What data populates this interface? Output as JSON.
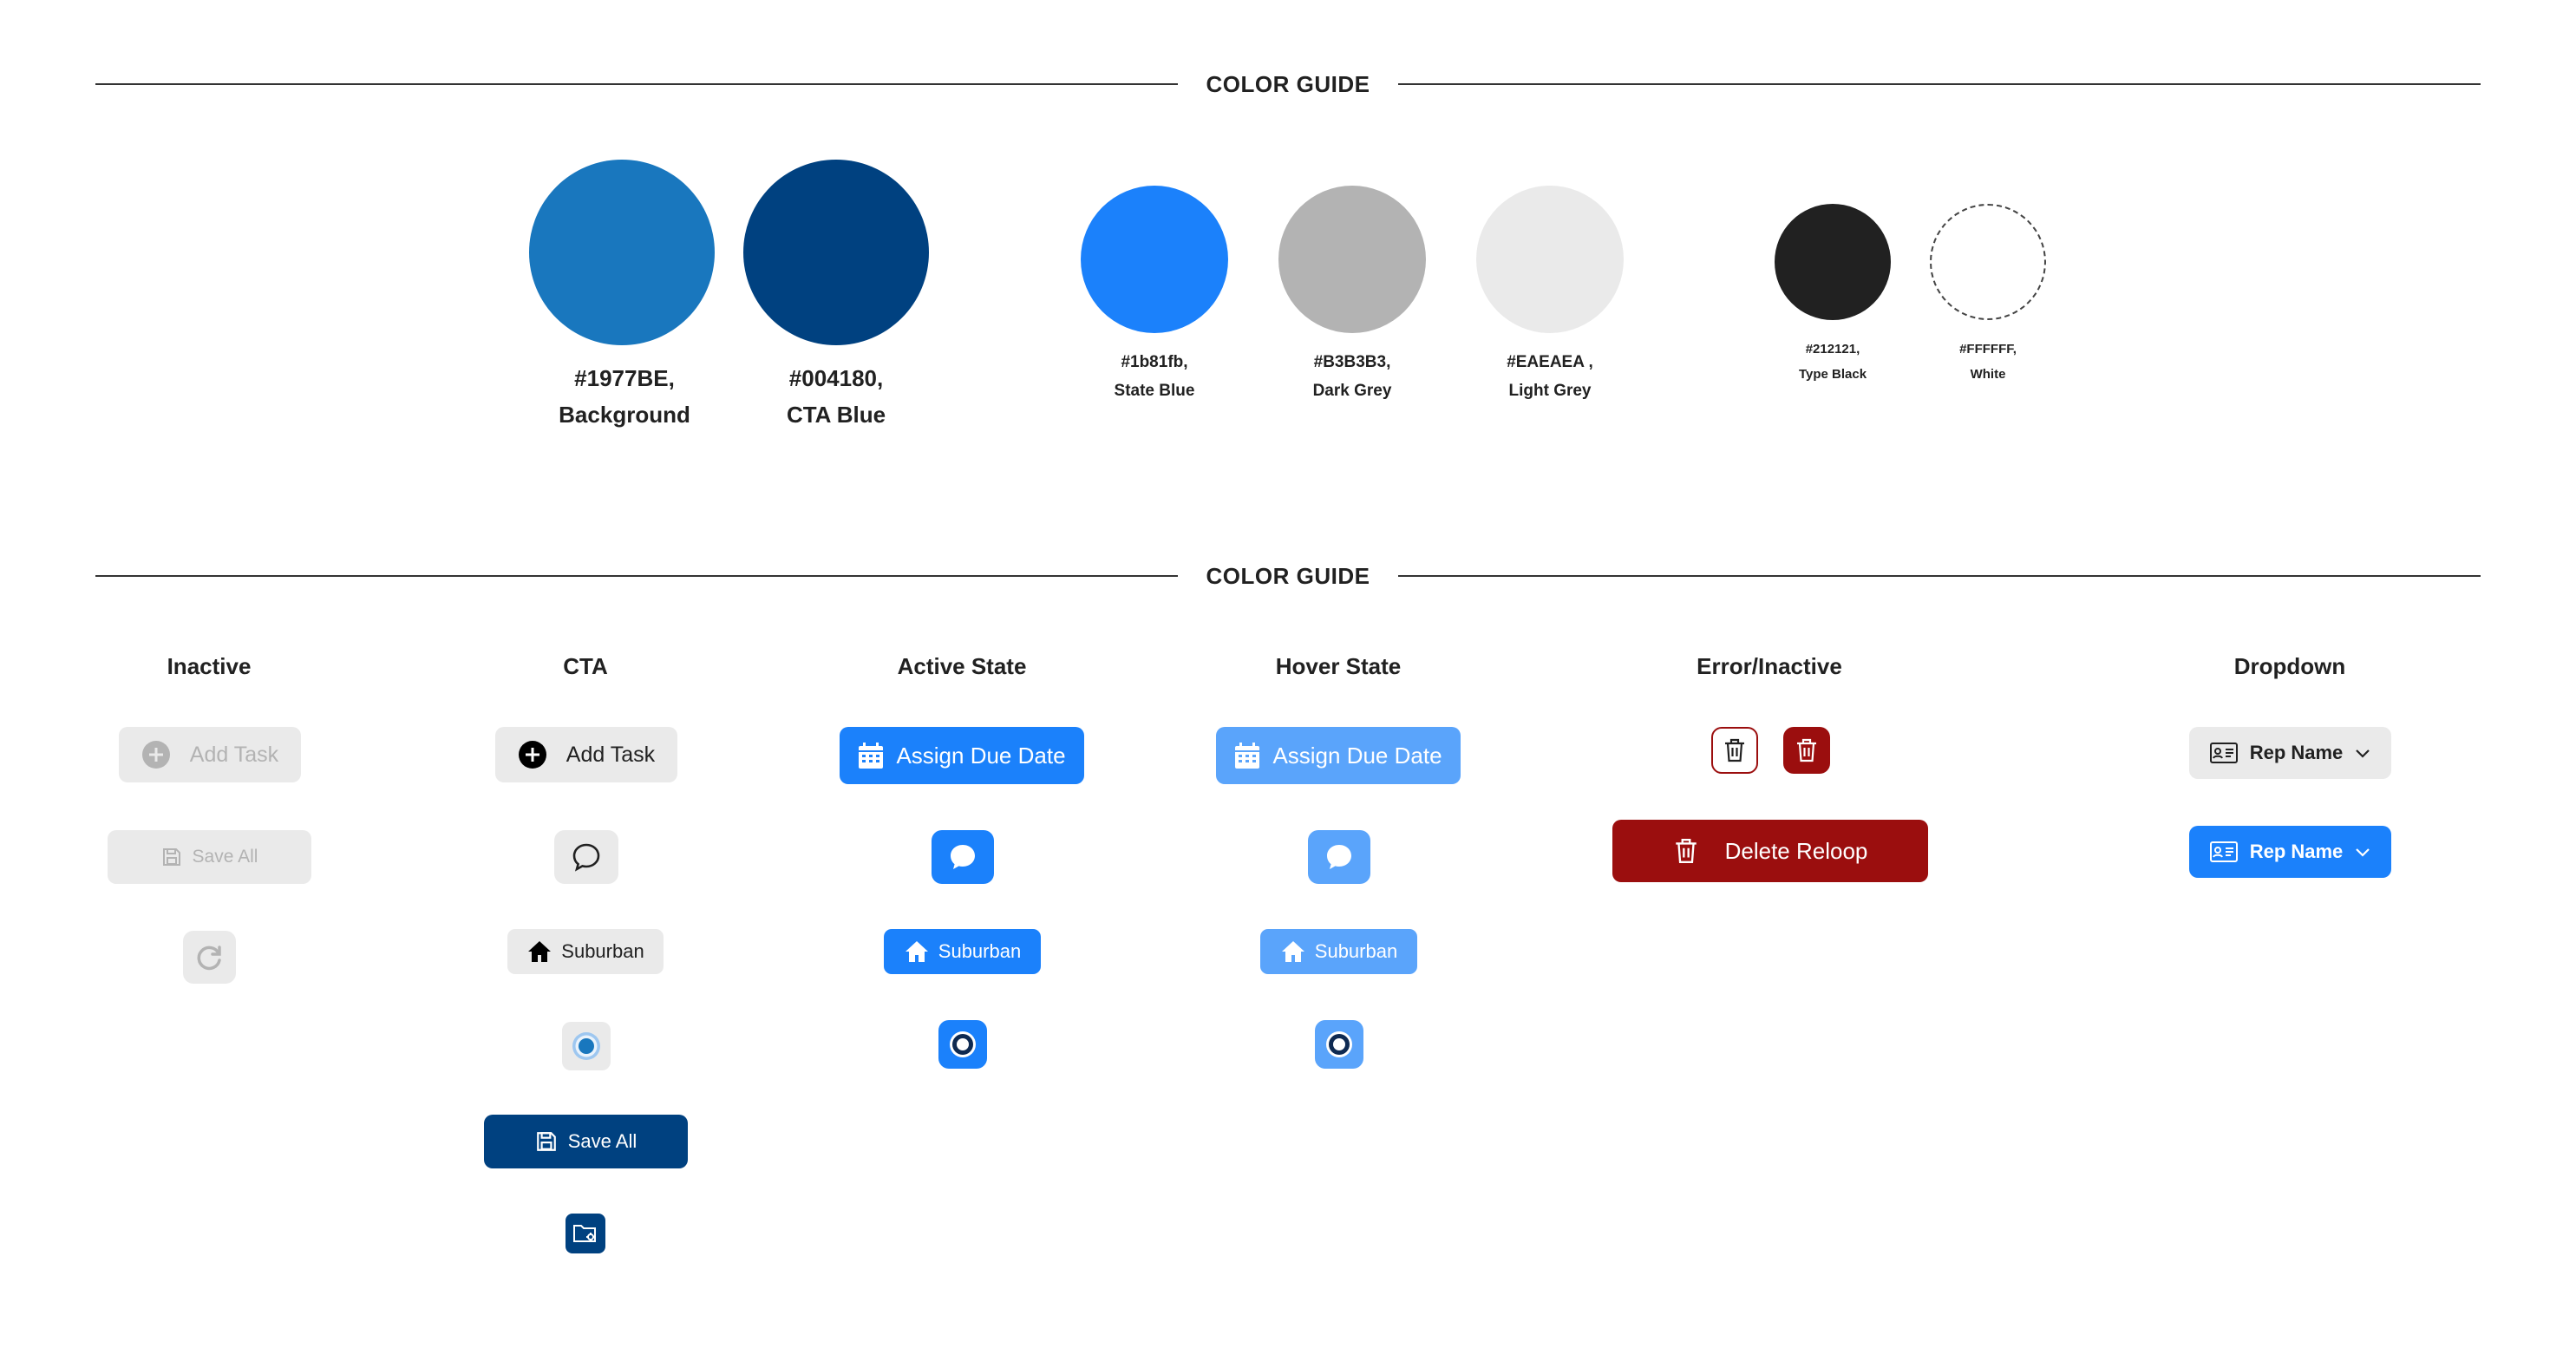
{
  "sections": {
    "top_title": "COLOR GUIDE",
    "bottom_title": "COLOR GUIDE"
  },
  "swatches": [
    {
      "hex": "#1977BE",
      "label_line1": "#1977BE,",
      "label_line2": "Background",
      "color": "#1977BE"
    },
    {
      "hex": "#004180",
      "label_line1": "#004180,",
      "label_line2": "CTA Blue",
      "color": "#004180"
    },
    {
      "hex": "#1b81fb",
      "label_line1": "#1b81fb,",
      "label_line2": "State Blue",
      "color": "#1B81FB"
    },
    {
      "hex": "#B3B3B3",
      "label_line1": "#B3B3B3,",
      "label_line2": "Dark Grey",
      "color": "#B3B3B3"
    },
    {
      "hex": "#EAEAEA",
      "label_line1": "#EAEAEA ,",
      "label_line2": "Light Grey",
      "color": "#EAEAEA"
    },
    {
      "hex": "#212121",
      "label_line1": "#212121,",
      "label_line2": "Type Black",
      "color": "#212121"
    },
    {
      "hex": "#FFFFFF",
      "label_line1": "#FFFFFF,",
      "label_line2": "White",
      "color": "#FFFFFF"
    }
  ],
  "columns": {
    "inactive": "Inactive",
    "cta": "CTA",
    "active": "Active State",
    "hover": "Hover State",
    "error": "Error/Inactive",
    "dropdown": "Dropdown"
  },
  "inactive": {
    "add_task": "Add Task",
    "save_all": "Save All"
  },
  "cta": {
    "add_task": "Add Task",
    "suburban": "Suburban",
    "save_all": "Save All"
  },
  "active": {
    "assign_due_date": "Assign Due Date",
    "suburban": "Suburban"
  },
  "hover": {
    "assign_due_date": "Assign Due Date",
    "suburban": "Suburban"
  },
  "error": {
    "delete_reloop": "Delete Reloop"
  },
  "dropdown": {
    "rep_name_default": "Rep Name",
    "rep_name_active": "Rep Name"
  },
  "colors": {
    "background": "#1977BE",
    "cta_blue": "#004180",
    "state_blue": "#1B81FB",
    "hover_blue": "#5AA4FB",
    "dark_grey": "#B3B3B3",
    "light_grey": "#EAEAEA",
    "type_black": "#212121",
    "error_red": "#9B0E0E"
  },
  "icons": [
    "plus-circle-icon",
    "save-icon",
    "refresh-icon",
    "chat-bubble-icon",
    "home-icon",
    "radio-icon",
    "folder-settings-icon",
    "calendar-icon",
    "trash-icon",
    "contact-card-icon",
    "chevron-down-icon"
  ]
}
